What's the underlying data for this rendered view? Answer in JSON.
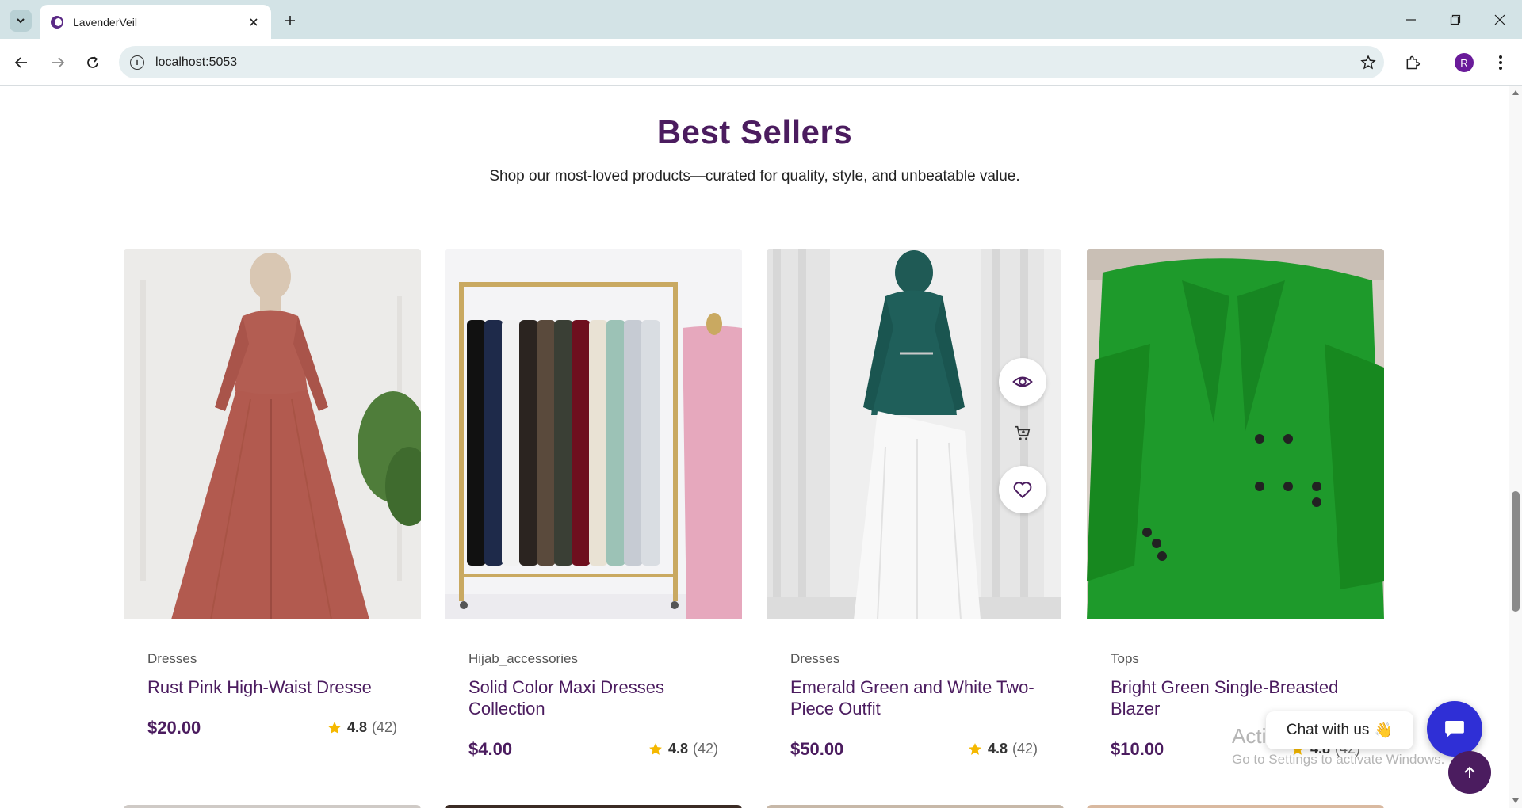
{
  "browser": {
    "tab_title": "LavenderVeil",
    "url": "localhost:5053",
    "avatar_initial": "R"
  },
  "section": {
    "title": "Best Sellers",
    "subtitle": "Shop our most-loved products—curated for quality, style, and unbeatable value."
  },
  "products": [
    {
      "category": "Dresses",
      "name": "Rust Pink High-Waist Dresse",
      "price": "$20.00",
      "rating": "4.8",
      "reviews": "(42)"
    },
    {
      "category": "Hijab_accessories",
      "name": "Solid Color Maxi Dresses Collection",
      "price": "$4.00",
      "rating": "4.8",
      "reviews": "(42)"
    },
    {
      "category": "Dresses",
      "name": "Emerald Green and White Two-Piece Outfit",
      "price": "$50.00",
      "rating": "4.8",
      "reviews": "(42)"
    },
    {
      "category": "Tops",
      "name": "Bright Green Single-Breasted Blazer",
      "price": "$10.00",
      "rating": "4.8",
      "reviews": "(42)"
    }
  ],
  "chat": {
    "label": "Chat with us",
    "emoji": "👋"
  },
  "watermark": {
    "line1": "Activate Windows",
    "line2": "Go to Settings to activate Windows."
  },
  "colors": {
    "brand_purple": "#4b1c5f",
    "chat_blue": "#2f2fd6",
    "star_gold": "#f5b800"
  }
}
